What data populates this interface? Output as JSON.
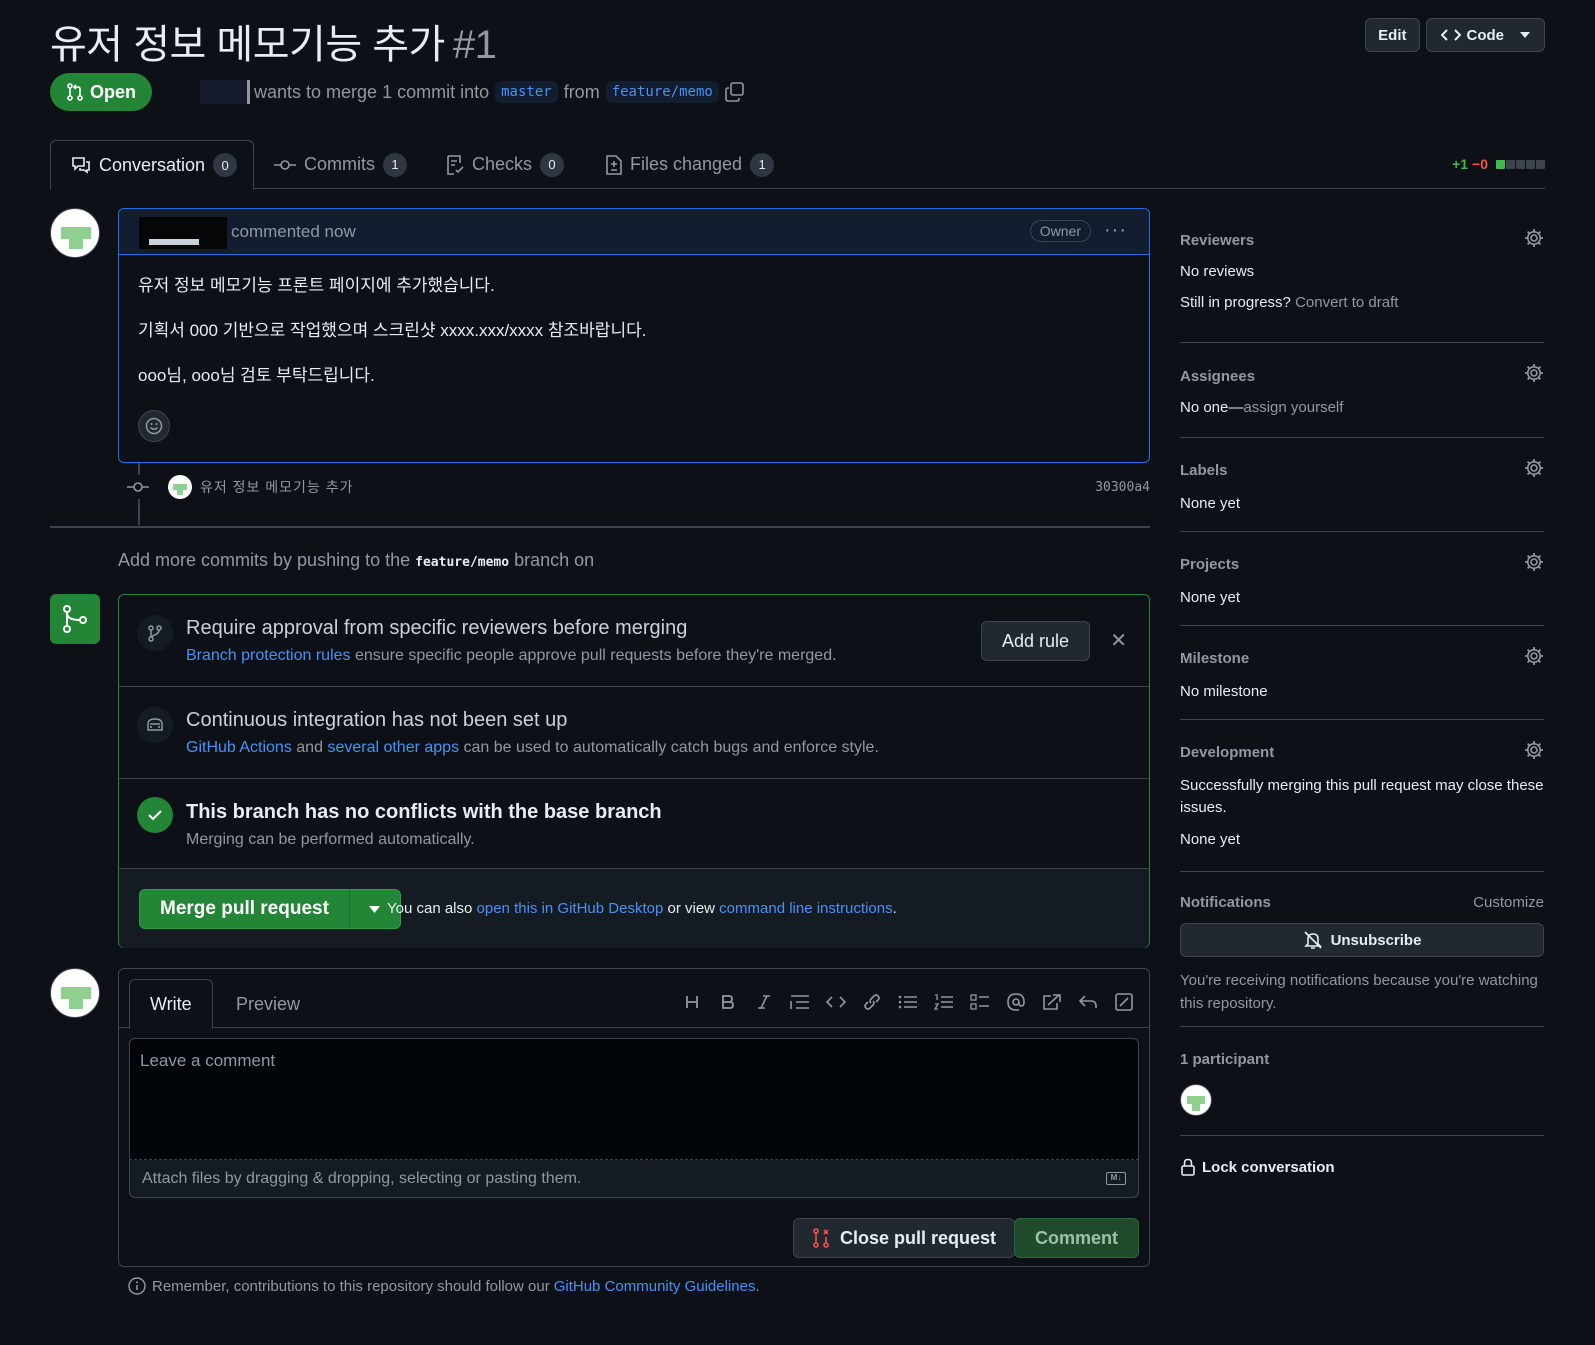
{
  "header": {
    "title": "유저 정보 메모기능 추가",
    "number": "#1",
    "edit_label": "Edit",
    "code_label": "Code",
    "state": "Open",
    "merge_sentence_prefix": "wants to merge 1 commit into",
    "base_branch": "master",
    "from_word": "from",
    "head_branch": "feature/memo"
  },
  "tabs": [
    {
      "label": "Conversation",
      "count": "0"
    },
    {
      "label": "Commits",
      "count": "1"
    },
    {
      "label": "Checks",
      "count": "0"
    },
    {
      "label": "Files changed",
      "count": "1"
    }
  ],
  "diffstat": {
    "additions": "+1",
    "deletions": "−0",
    "add_blocks": 1,
    "total_blocks": 5
  },
  "comment": {
    "meta": "commented now",
    "role_badge": "Owner",
    "paragraphs": [
      "유저 정보 메모기능 프론트 페이지에 추가했습니다.",
      "기획서 000 기반으로 작업했으며 스크린샷 xxxx.xxx/xxxx 참조바랍니다.",
      "ooo님, ooo님 검토 부탁드립니다."
    ]
  },
  "commit": {
    "message": "유저 정보 메모기능 추가",
    "sha": "30300a4"
  },
  "push_hint": {
    "prefix": "Add more commits by pushing to the",
    "branch": "feature/memo",
    "suffix": "branch on"
  },
  "merge_box": {
    "approval_title": "Require approval from specific reviewers before merging",
    "approval_link": "Branch protection rules",
    "approval_desc": "ensure specific people approve pull requests before they're merged.",
    "add_rule_label": "Add rule",
    "ci_title": "Continuous integration has not been set up",
    "ci_link1": "GitHub Actions",
    "ci_and": "and",
    "ci_link2": "several other apps",
    "ci_desc": "can be used to automatically catch bugs and enforce style.",
    "conflict_title": "This branch has no conflicts with the base branch",
    "conflict_desc": "Merging can be performed automatically.",
    "merge_button": "Merge pull request",
    "also_prefix": "You can also",
    "also_link1": "open this in GitHub Desktop",
    "also_mid": "or view",
    "also_link2": "command line instructions",
    "also_end": "."
  },
  "composer": {
    "write_tab": "Write",
    "preview_tab": "Preview",
    "placeholder": "Leave a comment",
    "attach_hint": "Attach files by dragging & dropping, selecting or pasting them.",
    "close_button": "Close pull request",
    "comment_button": "Comment"
  },
  "guidelines": {
    "prefix": "Remember, contributions to this repository should follow our",
    "link": "GitHub Community Guidelines",
    "end": "."
  },
  "sidebar": {
    "reviewers": {
      "title": "Reviewers",
      "value": "No reviews",
      "progress_q": "Still in progress?",
      "progress_link": "Convert to draft"
    },
    "assignees": {
      "title": "Assignees",
      "value": "No one—",
      "link": "assign yourself"
    },
    "labels": {
      "title": "Labels",
      "value": "None yet"
    },
    "projects": {
      "title": "Projects",
      "value": "None yet"
    },
    "milestone": {
      "title": "Milestone",
      "value": "No milestone"
    },
    "development": {
      "title": "Development",
      "desc": "Successfully merging this pull request may close these issues.",
      "value": "None yet"
    },
    "notifications": {
      "title": "Notifications",
      "customize": "Customize",
      "button": "Unsubscribe",
      "desc": "You're receiving notifications because you're watching this repository."
    },
    "participants": {
      "title": "1 participant"
    },
    "lock": "Lock conversation"
  },
  "colors": {
    "accent_green": "#238636",
    "link_blue": "#4493f8",
    "bg": "#0d1117",
    "border": "#3d444d"
  }
}
